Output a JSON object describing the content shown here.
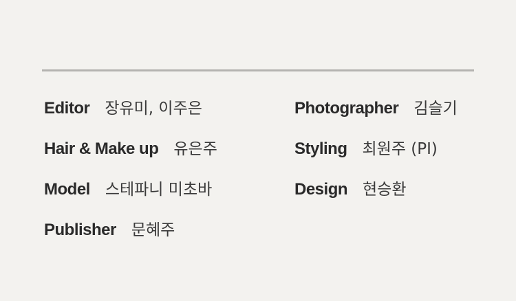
{
  "credits": [
    {
      "role": "Editor",
      "name": "장유미, 이주은"
    },
    {
      "role": "Hair & Make up",
      "name": "유은주"
    },
    {
      "role": "Model",
      "name": "스테파니 미초바"
    },
    {
      "role": "Publisher",
      "name": "문혜주"
    },
    {
      "role": "Photographer",
      "name": "김슬기"
    },
    {
      "role": "Styling",
      "name": "최원주 (PI)"
    },
    {
      "role": "Design",
      "name": "현승환"
    }
  ],
  "colors": {
    "background": "#f3f2ef",
    "rule": "#b4b3b0",
    "role_text": "#2a2a2a",
    "name_text": "#3a3a3a"
  }
}
